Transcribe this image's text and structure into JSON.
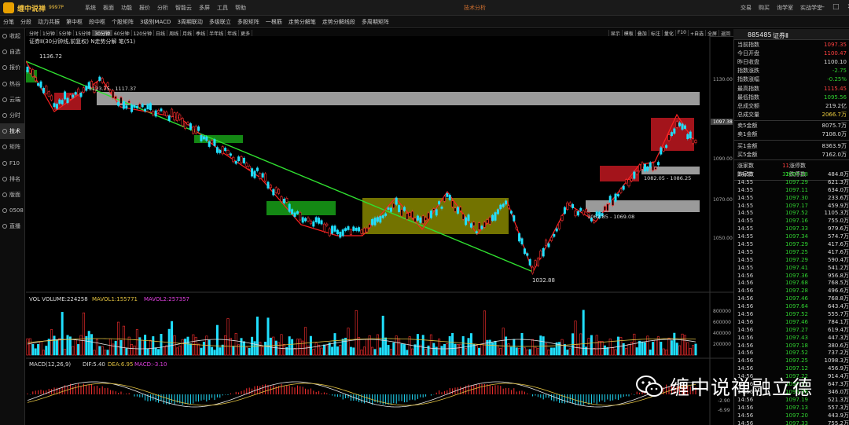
{
  "app": {
    "brand": "缠中说禅",
    "version": "9997P",
    "window_title": "技术分析",
    "menu": [
      "系统",
      "板面",
      "功能",
      "报价",
      "分析",
      "智能云",
      "多屏",
      "工具",
      "帮助"
    ],
    "right_links": [
      "交易",
      "购买",
      "询学室",
      "实战学堂"
    ],
    "win_buttons": [
      "—",
      "□",
      "✕"
    ]
  },
  "tabs": [
    "分笔",
    "分段",
    "动力共振",
    "第中枢",
    "段中枢",
    "个股矩阵",
    "3级别MACD",
    "3周期联动",
    "多级联立",
    "多股矩阵",
    "一根筋",
    "走势分解笔",
    "走势分解线段",
    "多周期矩阵"
  ],
  "sidebar": [
    {
      "label": "收起",
      "icon": "collapse-icon"
    },
    {
      "label": "自选",
      "icon": "star-icon"
    },
    {
      "label": "报价",
      "icon": "quote-icon"
    },
    {
      "label": "热谷",
      "icon": "fire-icon"
    },
    {
      "label": "云端",
      "icon": "cloud-icon"
    },
    {
      "label": "分时",
      "icon": "clock-icon"
    },
    {
      "label": "技术",
      "icon": "chart-icon"
    },
    {
      "label": "矩阵",
      "icon": "grid-icon"
    },
    {
      "label": "F10",
      "icon": "info-icon"
    },
    {
      "label": "排名",
      "icon": "rank-icon"
    },
    {
      "label": "版面",
      "icon": "layout-icon"
    },
    {
      "label": "0508",
      "icon": "calendar-icon"
    },
    {
      "label": "直播",
      "icon": "live-icon"
    }
  ],
  "periods": [
    "分时",
    "1分钟",
    "5分钟",
    "15分钟",
    "30分钟",
    "60分钟",
    "120分钟",
    "日线",
    "周线",
    "月线",
    "季线",
    "半年线",
    "年线",
    "更多"
  ],
  "active_period": "30分钟",
  "chart_tools": [
    "显示",
    "模板",
    "叠加",
    "标注",
    "量化",
    "F10",
    "+自选",
    "全屏",
    "返回"
  ],
  "chart_title": "证券Ⅱ(30分钟线,前复权) N走势分解  笔(51)",
  "main_chart": {
    "price_axis": [
      "1130.00",
      "1090.00",
      "1070.00",
      "1050.00"
    ],
    "current_price_tag": "1097.38",
    "labels": {
      "high": "1136.72",
      "low": "1032.88",
      "zone_top": "1123.75 - 1117.37",
      "zone_mid": "1082.05 - 1086.25",
      "zone_low": "1062.85 - 1069.08"
    }
  },
  "volume_panel": {
    "title": "VOL VOLUME:224258",
    "mavol1": "MAVOL1:155771",
    "mavol2": "MAVOL2:257357",
    "axis": [
      "800000",
      "600000",
      "400000",
      "200000"
    ]
  },
  "macd_panel": {
    "title": "MACD(12,26,9)",
    "dif": "DIF:5.40",
    "dea": "DEA:6.95",
    "macd": "MACD:-3.10",
    "axis": [
      "-2.90",
      "-6.99"
    ]
  },
  "right_panel": {
    "code": "885485",
    "name": "证券Ⅱ",
    "stats": [
      {
        "label": "当前指数",
        "value": "1097.35",
        "color": "#ff4040"
      },
      {
        "label": "今日开盘",
        "value": "1100.47",
        "color": "#ff4040"
      },
      {
        "label": "昨日收盘",
        "value": "1100.10",
        "color": "#dddddd"
      },
      {
        "label": "指数涨跌",
        "value": "-2.75",
        "color": "#30d030"
      },
      {
        "label": "指数涨幅",
        "value": "-0.25%",
        "color": "#30d030"
      },
      {
        "label": "最高指数",
        "value": "1115.45",
        "color": "#ff4040"
      },
      {
        "label": "最低指数",
        "value": "1095.56",
        "color": "#30d030"
      },
      {
        "label": "总成交额",
        "value": "219.2亿",
        "color": "#dddddd"
      },
      {
        "label": "总成交量",
        "value": "2066.7万",
        "color": "#f0d040"
      }
    ],
    "sell": [
      {
        "label": "卖5金额",
        "value": "8075.7万"
      },
      {
        "label": "卖1金额",
        "value": "7108.0万"
      }
    ],
    "buy": [
      {
        "label": "买1金额",
        "value": "8363.9万"
      },
      {
        "label": "买5金额",
        "value": "7162.0万"
      }
    ],
    "updown": [
      {
        "l1": "涨家数",
        "v1": "11",
        "l2": "涨停数",
        "v2": "0",
        "c": "#ff4040"
      },
      {
        "l1": "跌家数",
        "v1": "32",
        "l2": "跌停数",
        "v2": "0",
        "c": "#30d030"
      }
    ],
    "ticks": [
      {
        "t": "14:55",
        "p": "1097.28",
        "v": "484.8万",
        "c": "#30d030"
      },
      {
        "t": "14:55",
        "p": "1097.29",
        "v": "621.3万",
        "c": "#30d030"
      },
      {
        "t": "14:55",
        "p": "1097.11",
        "v": "634.0万",
        "c": "#30d030"
      },
      {
        "t": "14:55",
        "p": "1097.30",
        "v": "233.6万",
        "c": "#30d030"
      },
      {
        "t": "14:55",
        "p": "1097.17",
        "v": "459.9万",
        "c": "#30d030"
      },
      {
        "t": "14:55",
        "p": "1097.52",
        "v": "1105.3万",
        "c": "#30d030"
      },
      {
        "t": "14:55",
        "p": "1097.16",
        "v": "755.0万",
        "c": "#30d030"
      },
      {
        "t": "14:55",
        "p": "1097.33",
        "v": "979.6万",
        "c": "#30d030"
      },
      {
        "t": "14:55",
        "p": "1097.34",
        "v": "574.7万",
        "c": "#30d030"
      },
      {
        "t": "14:55",
        "p": "1097.29",
        "v": "417.6万",
        "c": "#30d030"
      },
      {
        "t": "14:55",
        "p": "1097.25",
        "v": "417.6万",
        "c": "#30d030"
      },
      {
        "t": "14:55",
        "p": "1097.29",
        "v": "590.4万",
        "c": "#30d030"
      },
      {
        "t": "14:55",
        "p": "1097.41",
        "v": "541.2万",
        "c": "#30d030"
      },
      {
        "t": "14:56",
        "p": "1097.36",
        "v": "956.8万",
        "c": "#30d030"
      },
      {
        "t": "14:56",
        "p": "1097.68",
        "v": "768.5万",
        "c": "#30d030"
      },
      {
        "t": "14:56",
        "p": "1097.28",
        "v": "496.6万",
        "c": "#30d030"
      },
      {
        "t": "14:56",
        "p": "1097.46",
        "v": "768.8万",
        "c": "#30d030"
      },
      {
        "t": "14:56",
        "p": "1097.64",
        "v": "643.4万",
        "c": "#30d030"
      },
      {
        "t": "14:56",
        "p": "1097.52",
        "v": "555.7万",
        "c": "#30d030"
      },
      {
        "t": "14:56",
        "p": "1097.46",
        "v": "784.1万",
        "c": "#30d030"
      },
      {
        "t": "14:56",
        "p": "1097.27",
        "v": "619.4万",
        "c": "#30d030"
      },
      {
        "t": "14:56",
        "p": "1097.43",
        "v": "447.3万",
        "c": "#30d030"
      },
      {
        "t": "14:56",
        "p": "1097.18",
        "v": "380.6万",
        "c": "#30d030"
      },
      {
        "t": "14:56",
        "p": "1097.52",
        "v": "737.2万",
        "c": "#30d030"
      },
      {
        "t": "14:56",
        "p": "1097.25",
        "v": "1098.3万",
        "c": "#30d030"
      },
      {
        "t": "14:56",
        "p": "1097.12",
        "v": "456.9万",
        "c": "#30d030"
      },
      {
        "t": "14:56",
        "p": "1097.22",
        "v": "914.4万",
        "c": "#30d030"
      },
      {
        "t": "14:56",
        "p": "1097.11",
        "v": "647.3万",
        "c": "#30d030"
      },
      {
        "t": "14:56",
        "p": "1096.98",
        "v": "346.0万",
        "c": "#30d030"
      },
      {
        "t": "14:56",
        "p": "1097.19",
        "v": "521.3万",
        "c": "#30d030"
      },
      {
        "t": "14:56",
        "p": "1097.13",
        "v": "557.3万",
        "c": "#30d030"
      },
      {
        "t": "14:56",
        "p": "1097.20",
        "v": "443.9万",
        "c": "#30d030"
      },
      {
        "t": "14:56",
        "p": "1097.33",
        "v": "755.2万",
        "c": "#30d030"
      },
      {
        "t": "14:56",
        "p": "1097.29",
        "v": "75.3万",
        "c": "#30d030"
      }
    ]
  },
  "watermark": "缠中说禅融立德",
  "colors": {
    "up": "#ff3030",
    "down": "#30d030",
    "cyan": "#20e0ff",
    "yellow": "#e0e000",
    "green_line": "#30e030"
  }
}
